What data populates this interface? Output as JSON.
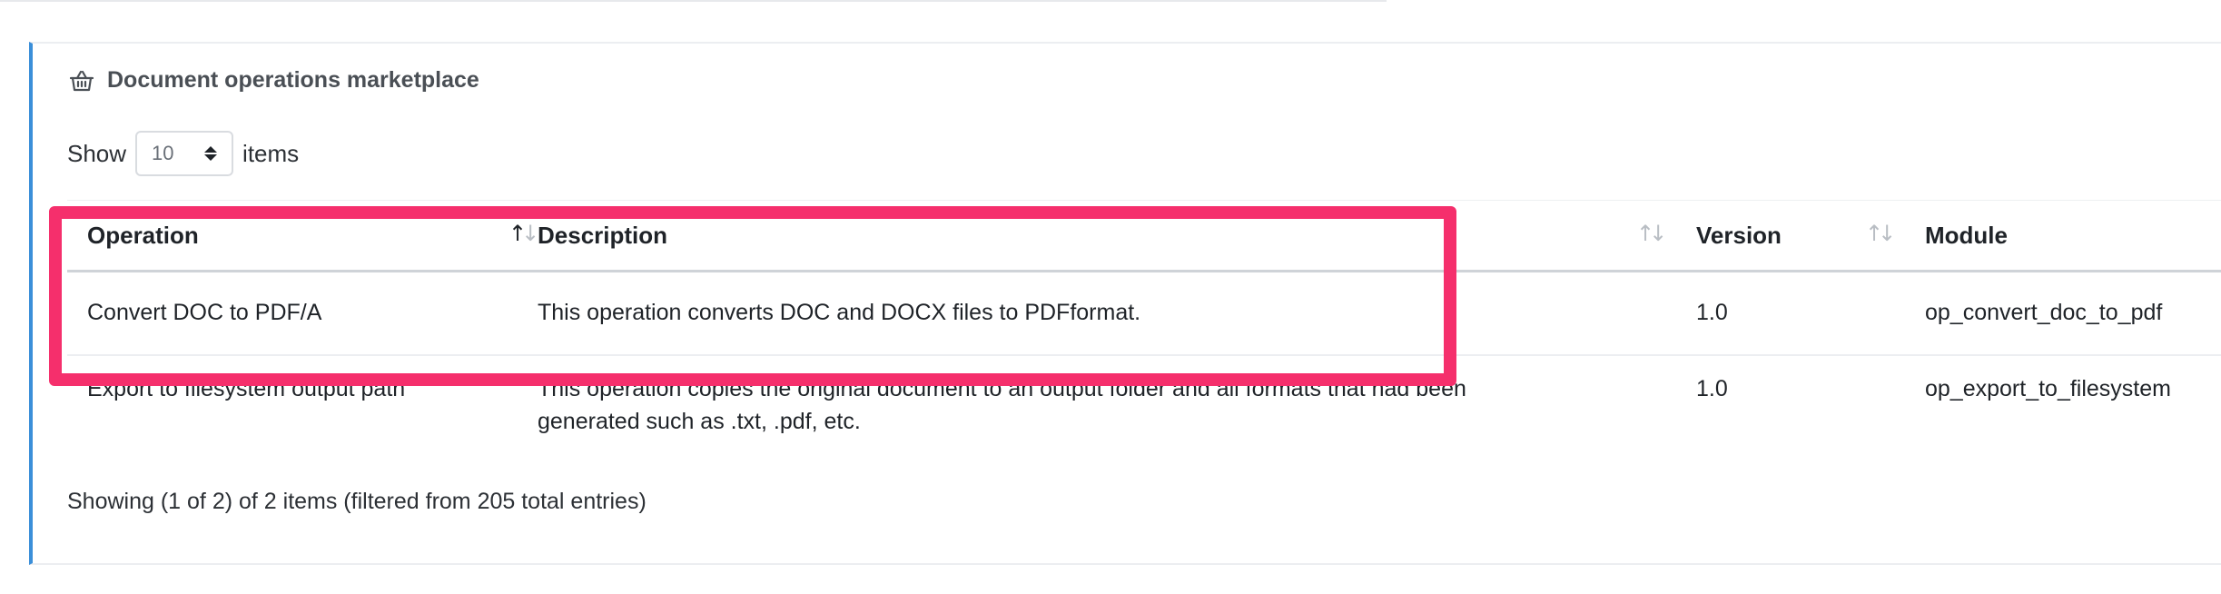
{
  "panel": {
    "title": "Document operations marketplace",
    "title_icon": "basket-icon",
    "accent_color": "#3b8fd9"
  },
  "length_control": {
    "show_label": "Show",
    "selected_value": "10",
    "items_label": "items"
  },
  "table": {
    "columns": [
      "Operation",
      "Description",
      "Version",
      "Module"
    ],
    "rows": [
      {
        "operation": "Convert DOC to PDF/A",
        "description": "This operation converts DOC and DOCX files to PDFformat.",
        "version": "1.0",
        "module": "op_convert_doc_to_pdf"
      },
      {
        "operation": "Export to filesystem output path",
        "description_line1": "This operation copies the original document to an output folder and all formats that had been",
        "description_line2": "generated such as .txt, .pdf, etc.",
        "version": "1.0",
        "module": "op_export_to_filesystem"
      }
    ]
  },
  "footer": {
    "info": "Showing (1 of 2) of 2 items (filtered from 205 total entries)"
  },
  "highlight_color": "#f52f6c"
}
